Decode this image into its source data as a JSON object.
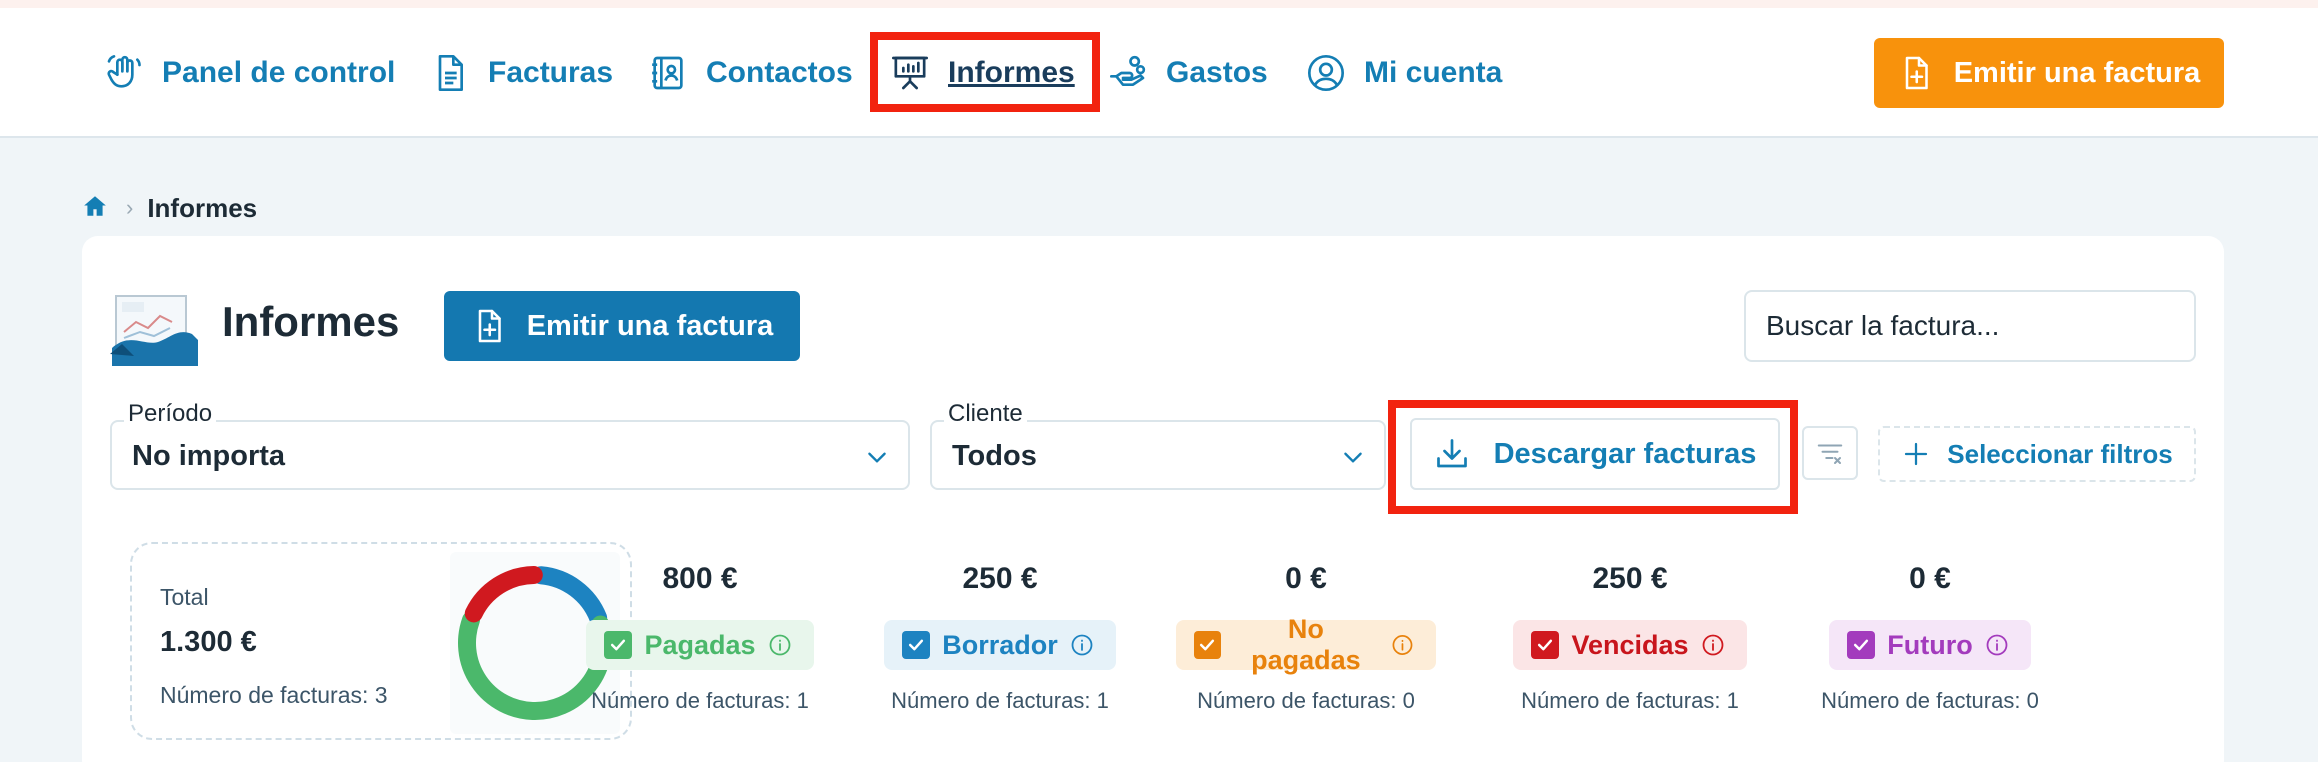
{
  "nav": {
    "items": [
      {
        "label": "Panel de control",
        "icon": "hand-wave-icon"
      },
      {
        "label": "Facturas",
        "icon": "document-icon"
      },
      {
        "label": "Contactos",
        "icon": "contact-book-icon"
      },
      {
        "label": "Informes",
        "icon": "presentation-board-icon",
        "active": true
      },
      {
        "label": "Gastos",
        "icon": "hand-coins-icon"
      },
      {
        "label": "Mi cuenta",
        "icon": "user-circle-icon"
      }
    ],
    "cta_label": "Emitir una factura"
  },
  "breadcrumb": {
    "current": "Informes"
  },
  "page": {
    "title": "Informes",
    "issue_button": "Emitir una factura",
    "search_placeholder": "Buscar la factura..."
  },
  "filters": {
    "period": {
      "label": "Período",
      "value": "No importa"
    },
    "client": {
      "label": "Cliente",
      "value": "Todos"
    },
    "download_label": "Descargar facturas",
    "select_filters_label": "Seleccionar filtros"
  },
  "summary": {
    "total_label": "Total",
    "total_value": "1.300 €",
    "count_label": "Número de facturas: 3",
    "donut": [
      {
        "name": "Pagadas",
        "value": 800,
        "color": "#4bb86b"
      },
      {
        "name": "Borrador",
        "value": 250,
        "color": "#1d83c1"
      },
      {
        "name": "Vencidas",
        "value": 250,
        "color": "#d0191f"
      }
    ]
  },
  "stats": [
    {
      "amount": "800 €",
      "label": "Pagadas",
      "count": "Número de facturas: 1",
      "color": "#4bb86b",
      "bg": "#e8f6ec",
      "text": "#4bb86b"
    },
    {
      "amount": "250 €",
      "label": "Borrador",
      "count": "Número de facturas: 1",
      "color": "#1d83c1",
      "bg": "#e6f2f9",
      "text": "#1d83c1"
    },
    {
      "amount": "0 €",
      "label": "No pagadas",
      "count": "Número de facturas: 0",
      "color": "#e8820c",
      "bg": "#fdedd8",
      "text": "#e8820c"
    },
    {
      "amount": "250 €",
      "label": "Vencidas",
      "count": "Número de facturas: 1",
      "color": "#d0191f",
      "bg": "#fbe5e6",
      "text": "#c8151c"
    },
    {
      "amount": "0 €",
      "label": "Futuro",
      "count": "Número de facturas: 0",
      "color": "#a33bbd",
      "bg": "#f5e6f8",
      "text": "#a33bbd"
    }
  ]
}
